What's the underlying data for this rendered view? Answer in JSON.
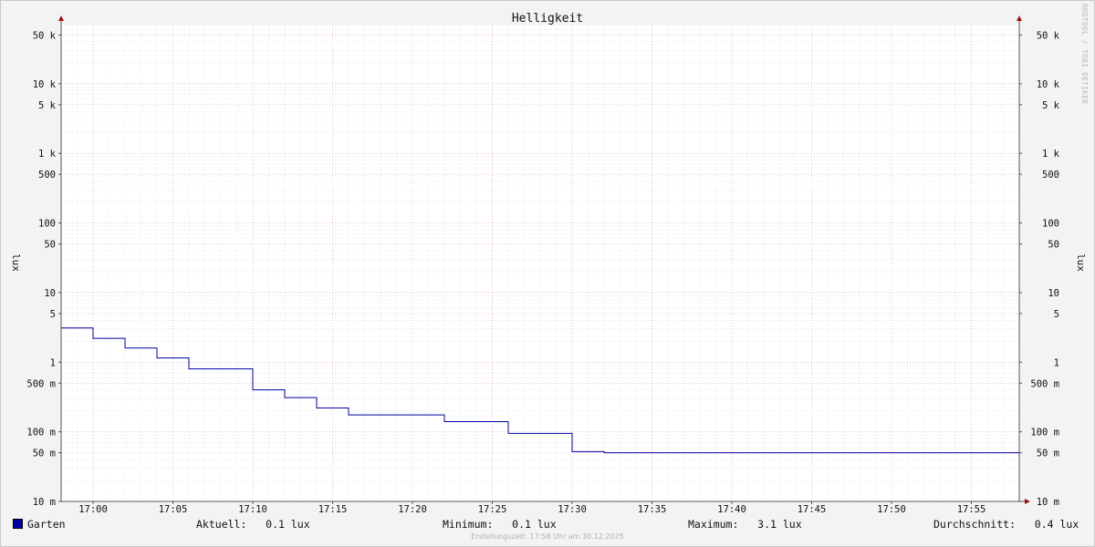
{
  "chart_data": {
    "type": "line",
    "title": "Helligkeit",
    "ylabel": "lux",
    "y_scale": "log",
    "ylim": [
      10,
      80000
    ],
    "xlim": [
      "16:58",
      "17:58"
    ],
    "grid": true,
    "x_ticks": [
      "17:00",
      "17:05",
      "17:10",
      "17:15",
      "17:20",
      "17:25",
      "17:30",
      "17:35",
      "17:40",
      "17:45",
      "17:50",
      "17:55"
    ],
    "y_ticks": [
      {
        "value": 50000,
        "label": "50 k"
      },
      {
        "value": 10000,
        "label": "10 k"
      },
      {
        "value": 5000,
        "label": "5 k"
      },
      {
        "value": 1000,
        "label": "1 k"
      },
      {
        "value": 500,
        "label": "500"
      },
      {
        "value": 100,
        "label": "100"
      },
      {
        "value": 50,
        "label": "50"
      },
      {
        "value": 10,
        "label": "10"
      },
      {
        "value": 5,
        "label": "5"
      },
      {
        "value": 1,
        "label": "1"
      },
      {
        "value": 0.5,
        "label": "500 m"
      },
      {
        "value": 0.1,
        "label": "100 m"
      },
      {
        "value": 0.05,
        "label": "50 m"
      },
      {
        "value": 0.01,
        "label": "10 m"
      }
    ],
    "series": [
      {
        "name": "Garten",
        "color": "#0000a0",
        "x": [
          "16:58",
          "17:00",
          "17:02",
          "17:04",
          "17:06",
          "17:10",
          "17:12",
          "17:14",
          "17:16",
          "17:22",
          "17:26",
          "17:30",
          "17:32",
          "17:58"
        ],
        "values": [
          3.1,
          2.2,
          1.6,
          1.15,
          0.8,
          0.4,
          0.31,
          0.22,
          0.175,
          0.14,
          0.095,
          0.052,
          0.05,
          0.05
        ]
      }
    ]
  },
  "legend": {
    "series_name": "Garten",
    "current": "Aktuell:   0.1 lux",
    "minimum": "Minimum:   0.1 lux",
    "maximum": "Maximum:   3.1 lux",
    "average": "Durchschnitt:   0.4 lux"
  },
  "footer": "Erstellungszeit: 17:58 Uhr am 30.12.2025",
  "watermark": "RRDTOOL / TOBI OETIKER"
}
